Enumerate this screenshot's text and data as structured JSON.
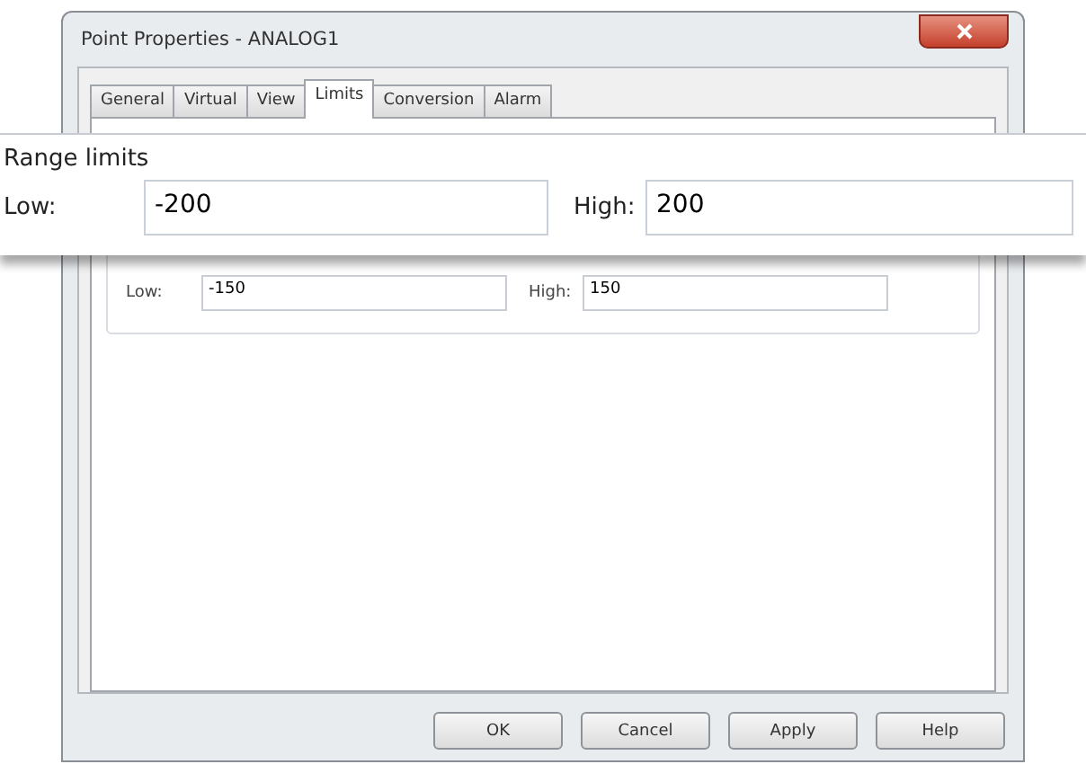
{
  "window": {
    "title": "Point Properties - ANALOG1"
  },
  "tabs": [
    {
      "label": "General",
      "selected": false
    },
    {
      "label": "Virtual",
      "selected": false
    },
    {
      "label": "View",
      "selected": false
    },
    {
      "label": "Limits",
      "selected": true
    },
    {
      "label": "Conversion",
      "selected": false
    },
    {
      "label": "Alarm",
      "selected": false
    }
  ],
  "limits": {
    "low_label": "Low:",
    "low_value": "-150",
    "high_label": "High:",
    "high_value": "150"
  },
  "magnified_callout": {
    "group_title": "Range limits",
    "low_label": "Low:",
    "low_value": "-200",
    "high_label": "High:",
    "high_value": "200"
  },
  "buttons": [
    "OK",
    "Cancel",
    "Apply",
    "Help"
  ]
}
